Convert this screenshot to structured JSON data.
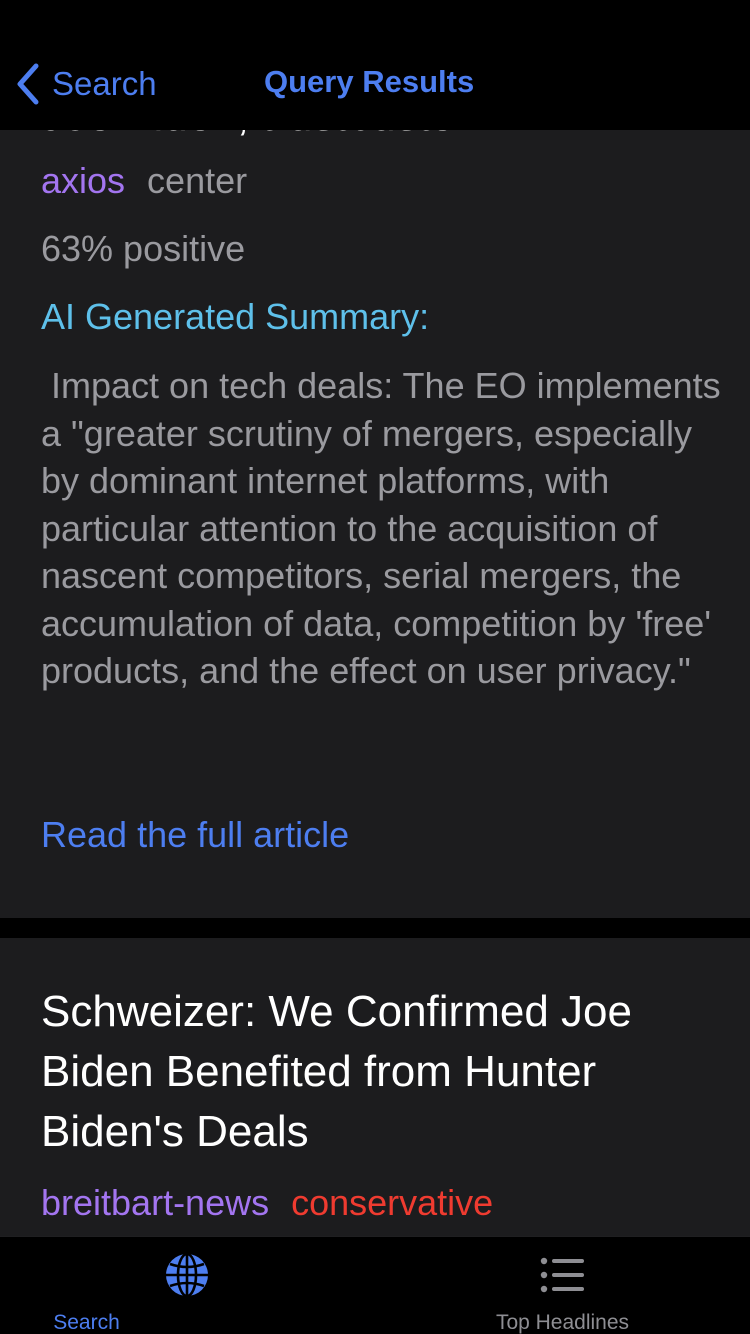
{
  "nav": {
    "back_label": "Search",
    "title": "Query Results"
  },
  "articles": [
    {
      "title": "Joe Biden, trustbuster",
      "source": "axios",
      "bias": "center",
      "sentiment": "63% positive",
      "summary_label": "AI Generated Summary:",
      "summary": " Impact on tech deals: The EO implements a \"greater scrutiny of mergers, especially by dominant internet platforms, with particular attention to the acquisition of nascent competitors, serial mergers, the accumulation of data, competition by 'free' products, and the effect on user privacy.\"",
      "link_label": "Read the full article"
    },
    {
      "title": "Schweizer: We Confirmed Joe Biden Benefited from Hunter Biden's Deals",
      "source": "breitbart-news",
      "bias": "conservative"
    }
  ],
  "tabbar": {
    "tabs": [
      {
        "label": "Search",
        "icon": "globe-icon",
        "selected": true
      },
      {
        "label": "Top Headlines",
        "icon": "list-icon",
        "selected": false
      }
    ]
  },
  "colors": {
    "accent": "#4d7ef0",
    "source": "#a375f0",
    "summary_label": "#5ec0ea",
    "conservative": "#ef3b30",
    "secondary_text": "#9a9a9f",
    "card_background": "#1c1c1e"
  }
}
